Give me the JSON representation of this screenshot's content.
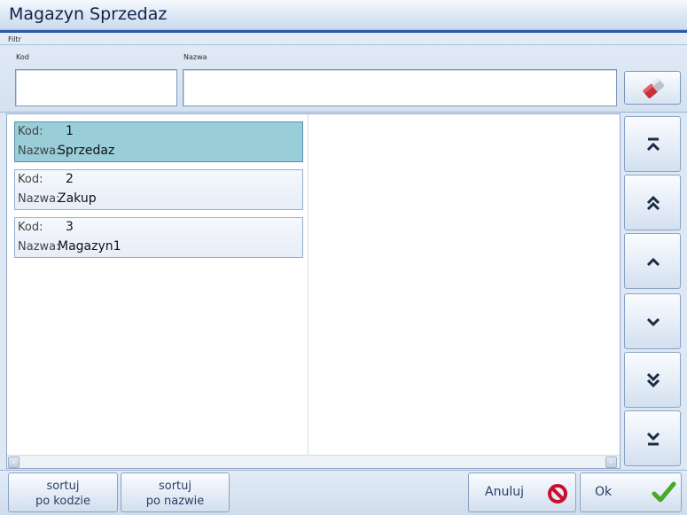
{
  "window": {
    "title": "Magazyn Sprzedaz"
  },
  "filter": {
    "section_label": "Filtr",
    "kod_label": "Kod",
    "nazwa_label": "Nazwa",
    "kod_value": "",
    "nazwa_value": "",
    "clear_icon": "eraser-icon"
  },
  "list": {
    "kod_label": "Kod:",
    "nazwa_label": "Nazwa:",
    "items": [
      {
        "kod": "1",
        "nazwa": "Sprzedaz",
        "selected": true
      },
      {
        "kod": "2",
        "nazwa": "Zakup",
        "selected": false
      },
      {
        "kod": "3",
        "nazwa": "Magazyn1",
        "selected": false
      }
    ],
    "selected_color": "#99cdd8"
  },
  "nav_icons": [
    "first-icon",
    "page-up-icon",
    "up-icon",
    "down-icon",
    "page-down-icon",
    "last-icon"
  ],
  "bottom": {
    "sort_kod": {
      "line1": "sortuj",
      "line2": "po kodzie"
    },
    "sort_nazwa": {
      "line1": "sortuj",
      "line2": "po nazwie"
    },
    "cancel_label": "Anuluj",
    "cancel_icon": "no-entry-icon",
    "ok_label": "Ok",
    "ok_icon": "checkmark-icon",
    "cancel_icon_color": "#c8102e",
    "ok_icon_color": "#4aa829"
  }
}
